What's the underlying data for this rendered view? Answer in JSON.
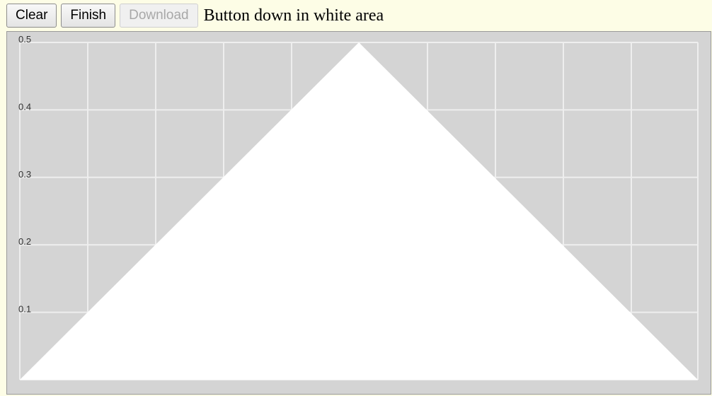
{
  "toolbar": {
    "clear_label": "Clear",
    "finish_label": "Finish",
    "download_label": "Download",
    "status_text": "Button down in white area"
  },
  "chart_data": {
    "type": "area",
    "yticks": [
      "0.1",
      "0.2",
      "0.3",
      "0.4",
      "0.5"
    ],
    "ylim": [
      0,
      0.5
    ],
    "x": [
      0,
      0.5,
      1
    ],
    "y": [
      0,
      0.5,
      0
    ],
    "grid": true,
    "colors": {
      "plot_bg": "#d4d4d4",
      "grid": "#eeeeee",
      "fill": "#ffffff"
    }
  }
}
